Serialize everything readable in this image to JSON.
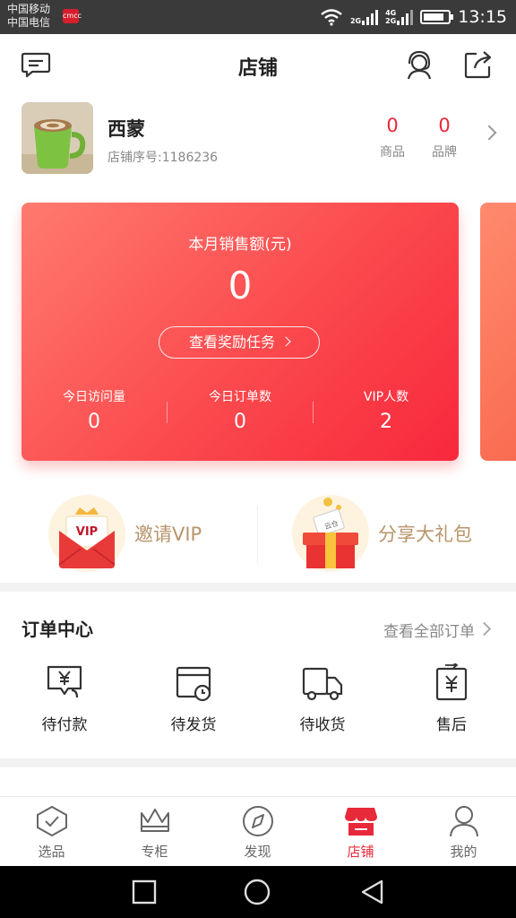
{
  "status_bar": {
    "carrier1": "中国移动",
    "carrier2": "中国电信",
    "badge": "cmcc",
    "net1": "2G",
    "net2a": "4G",
    "net2b": "2G",
    "battery_level": 0.85,
    "time": "13:15"
  },
  "header": {
    "title": "店铺",
    "icons": [
      "message-icon",
      "customer-service-icon",
      "share-icon"
    ]
  },
  "store": {
    "name": "西蒙",
    "serial": "店铺序号:1186236",
    "goods_count": "0",
    "goods_label": "商品",
    "brand_count": "0",
    "brand_label": "品牌"
  },
  "sales": {
    "label": "本月销售额(元)",
    "amount": "0",
    "reward_button": "查看奖励任务",
    "stats": [
      {
        "label": "今日访问量",
        "value": "0"
      },
      {
        "label": "今日订单数",
        "value": "0"
      },
      {
        "label": "VIP人数",
        "value": "2"
      }
    ]
  },
  "promo": {
    "invite_label": "邀请VIP",
    "invite_icon_text": "VIP",
    "gift_label": "分享大礼包",
    "gift_icon_text": "云仓"
  },
  "orders": {
    "title": "订单中心",
    "view_all": "查看全部订单",
    "items": [
      {
        "label": "待付款",
        "icon": "pending-payment-icon"
      },
      {
        "label": "待发货",
        "icon": "pending-shipment-icon"
      },
      {
        "label": "待收货",
        "icon": "pending-receipt-icon"
      },
      {
        "label": "售后",
        "icon": "after-sales-icon"
      }
    ]
  },
  "tabs": [
    {
      "label": "选品",
      "icon": "select-goods-icon"
    },
    {
      "label": "专柜",
      "icon": "crown-icon"
    },
    {
      "label": "发现",
      "icon": "compass-icon"
    },
    {
      "label": "店铺",
      "icon": "store-icon",
      "active": true
    },
    {
      "label": "我的",
      "icon": "profile-icon"
    }
  ],
  "colors": {
    "accent": "#e8293a",
    "card_gradient_start": "#ff7a6e",
    "card_gradient_end": "#f8283c",
    "promo_text": "#b8946a"
  }
}
